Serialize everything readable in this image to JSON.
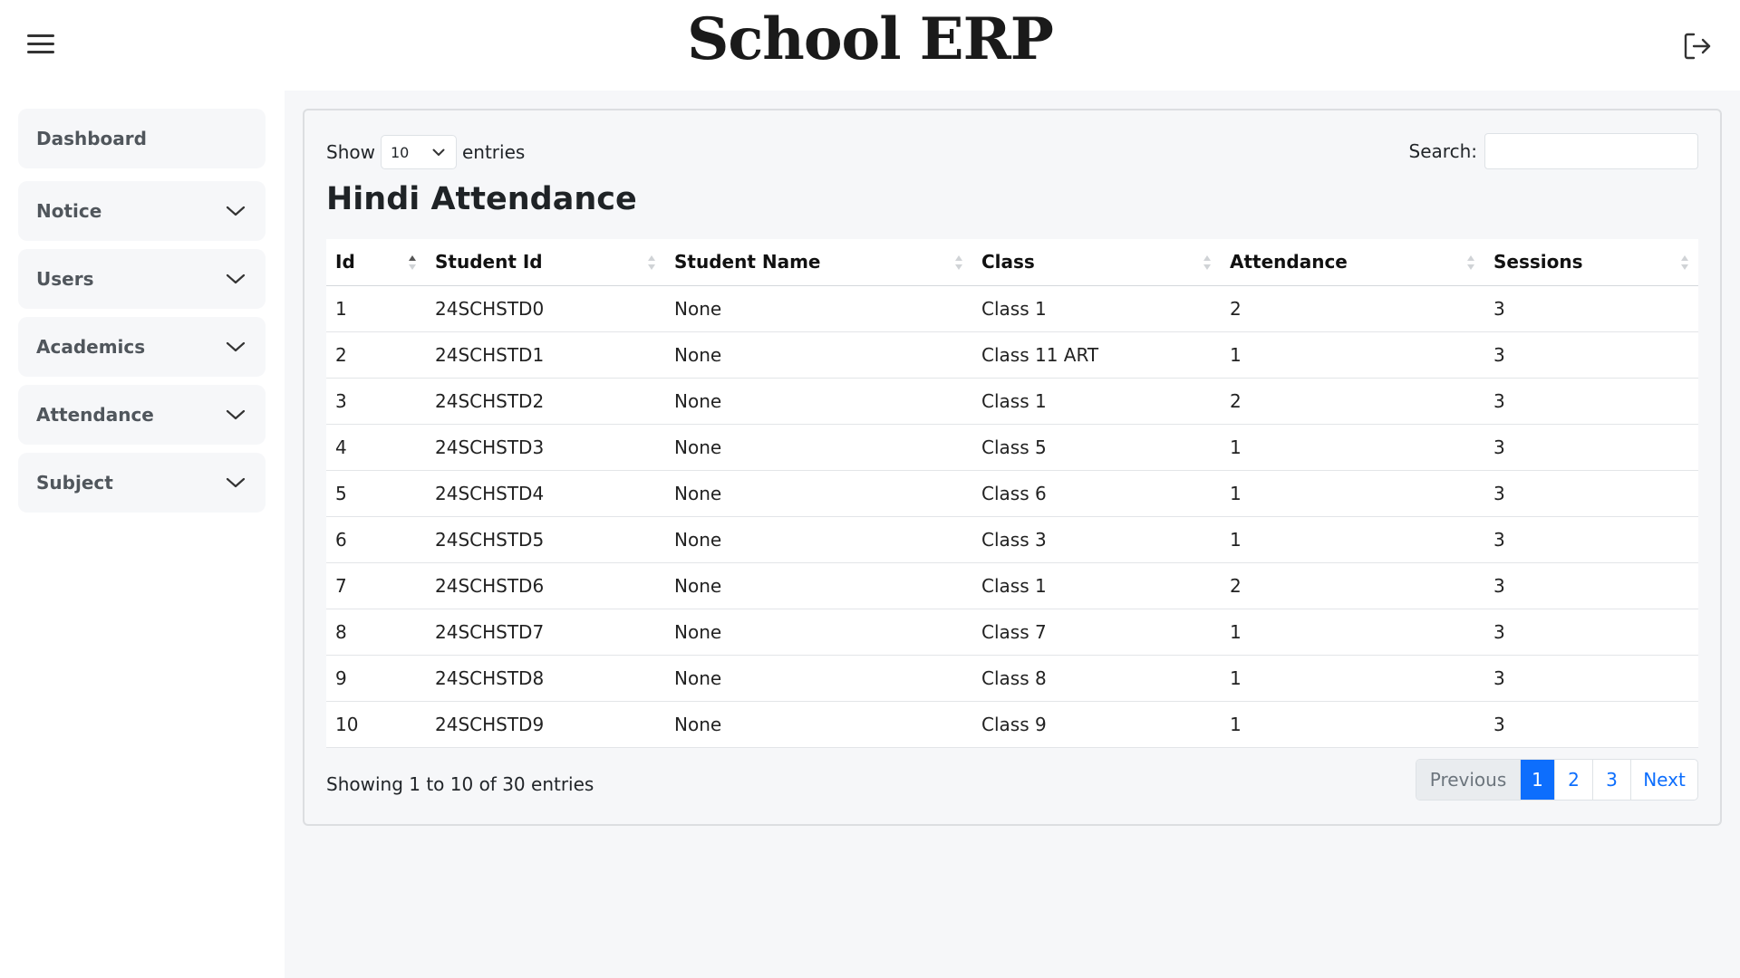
{
  "header": {
    "title": "School ERP"
  },
  "sidebar": {
    "items": [
      {
        "label": "Dashboard"
      },
      {
        "label": "Notice"
      },
      {
        "label": "Users"
      },
      {
        "label": "Academics"
      },
      {
        "label": "Attendance"
      },
      {
        "label": "Subject"
      }
    ]
  },
  "controls": {
    "show_label": "Show",
    "entries_label": "entries",
    "page_size": "10",
    "search_label": "Search:",
    "search_value": ""
  },
  "page": {
    "heading": "Hindi Attendance"
  },
  "table": {
    "columns": [
      "Id",
      "Student Id",
      "Student Name",
      "Class",
      "Attendance",
      "Sessions"
    ],
    "rows": [
      [
        "1",
        "24SCHSTD0",
        "None",
        "Class 1",
        "2",
        "3"
      ],
      [
        "2",
        "24SCHSTD1",
        "None",
        "Class 11 ART",
        "1",
        "3"
      ],
      [
        "3",
        "24SCHSTD2",
        "None",
        "Class 1",
        "2",
        "3"
      ],
      [
        "4",
        "24SCHSTD3",
        "None",
        "Class 5",
        "1",
        "3"
      ],
      [
        "5",
        "24SCHSTD4",
        "None",
        "Class 6",
        "1",
        "3"
      ],
      [
        "6",
        "24SCHSTD5",
        "None",
        "Class 3",
        "1",
        "3"
      ],
      [
        "7",
        "24SCHSTD6",
        "None",
        "Class 1",
        "2",
        "3"
      ],
      [
        "8",
        "24SCHSTD7",
        "None",
        "Class 7",
        "1",
        "3"
      ],
      [
        "9",
        "24SCHSTD8",
        "None",
        "Class 8",
        "1",
        "3"
      ],
      [
        "10",
        "24SCHSTD9",
        "None",
        "Class 9",
        "1",
        "3"
      ]
    ]
  },
  "footer": {
    "info": "Showing 1 to 10 of 30 entries",
    "pagination": {
      "previous": "Previous",
      "pages": [
        "1",
        "2",
        "3"
      ],
      "next": "Next"
    }
  },
  "icons": {
    "menu": "hamburger-menu-icon",
    "logout": "logout-icon",
    "expand": "chevron-down-icon",
    "sort": "sort-arrows-icon"
  },
  "colors": {
    "accent": "#0d6efd",
    "content_bg": "#f6f7f9"
  }
}
